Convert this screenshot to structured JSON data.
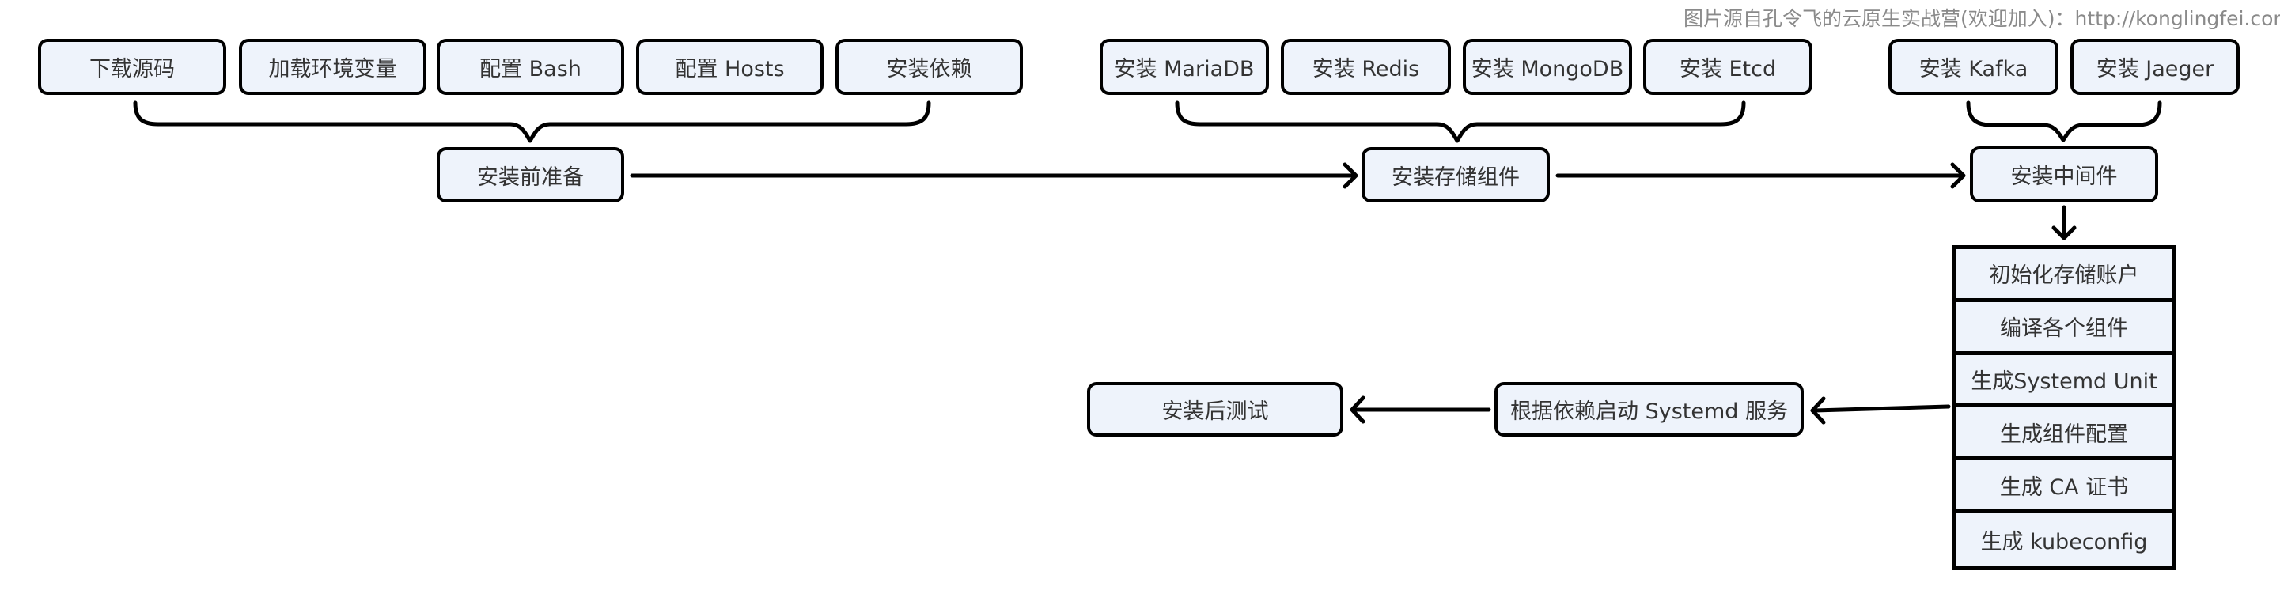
{
  "watermark": "图片源自孔令飞的云原生实战营(欢迎加入)：http://konglingfei.com",
  "groups": {
    "prep": {
      "items": [
        "下载源码",
        "加载环境变量",
        "配置 Bash",
        "配置 Hosts",
        "安装依赖"
      ],
      "summary": "安装前准备"
    },
    "storage": {
      "items": [
        "安装 MariaDB",
        "安装 Redis",
        "安装 MongoDB",
        "安装 Etcd"
      ],
      "summary": "安装存储组件"
    },
    "middleware": {
      "items": [
        "安装 Kafka",
        "安装 Jaeger"
      ],
      "summary": "安装中间件"
    }
  },
  "steps": [
    "初始化存储账户",
    "编译各个组件",
    "生成Systemd Unit",
    "生成组件配置",
    "生成 CA 证书",
    "生成 kubeconfig"
  ],
  "start_services": "根据依赖启动 Systemd 服务",
  "post_test": "安装后测试",
  "colors": {
    "box_fill": "#eef3fb",
    "stroke": "#000000",
    "text": "#333333",
    "watermark": "#8a8a8a"
  }
}
